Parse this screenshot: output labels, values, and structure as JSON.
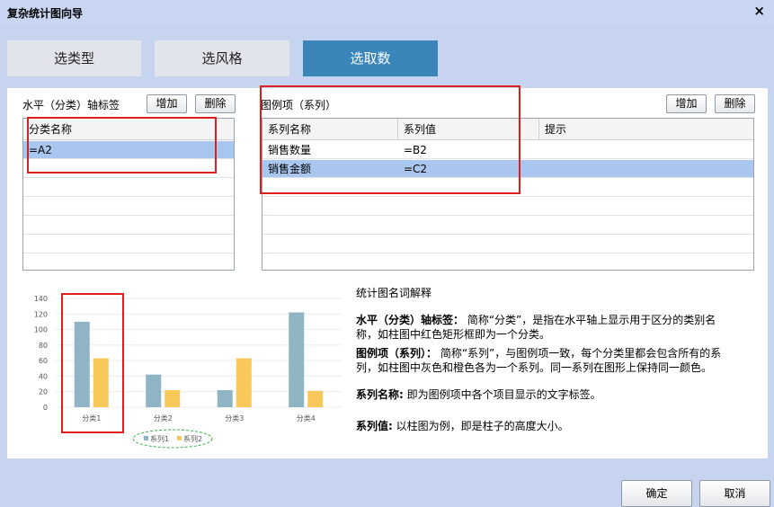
{
  "window": {
    "title": "复杂统计图向导",
    "close_glyph": "×"
  },
  "tabs": [
    {
      "label": "选类型",
      "active": false
    },
    {
      "label": "选风格",
      "active": false
    },
    {
      "label": "选取数",
      "active": true
    }
  ],
  "category_panel": {
    "label": "水平（分类）轴标签",
    "add_label": "增加",
    "delete_label": "删除",
    "column_header": "分类名称",
    "rows": [
      "=A2"
    ]
  },
  "series_panel": {
    "label": "图例项（系列）",
    "add_label": "增加",
    "delete_label": "删除",
    "columns": [
      "系列名称",
      "系列值",
      "提示"
    ],
    "rows": [
      {
        "name": "销售数量",
        "value": "=B2",
        "hint": ""
      },
      {
        "name": "销售金额",
        "value": "=C2",
        "hint": ""
      }
    ]
  },
  "explanation": {
    "title": "统计图名词解释",
    "items": [
      {
        "term": "水平（分类）轴标签：",
        "text": " 简称“分类”，是指在水平轴上显示用于区分的类别名称，如柱图中红色矩形框即为一个分类。"
      },
      {
        "term": "图例项（系列）：",
        "text": "  简称“系列”，与图例项一致，每个分类里都会包含所有的系列，如柱图中灰色和橙色各为一个系列。同一系列在图形上保持同一颜色。"
      },
      {
        "term": "系列名称:",
        "text": "  即为图例项中各个项目显示的文字标签。"
      },
      {
        "term": "系列值:",
        "text": "  以柱图为例，即是柱子的高度大小。"
      }
    ]
  },
  "footer": {
    "ok_label": "确定",
    "cancel_label": "取消"
  },
  "colors": {
    "accent_tab": "#3a85b9",
    "selected_row": "#a9c7ee",
    "highlight_frame": "#e01e1e",
    "series1": "#8fb4c4",
    "series2": "#f8c85a",
    "legend_oval": "#3cb34a"
  },
  "chart_data": {
    "type": "bar",
    "categories": [
      "分类1",
      "分类2",
      "分类3",
      "分类4"
    ],
    "series": [
      {
        "name": "系列1",
        "values": [
          110,
          42,
          22,
          122
        ]
      },
      {
        "name": "系列2",
        "values": [
          63,
          22,
          63,
          21
        ]
      }
    ],
    "ylim": [
      0,
      140
    ],
    "yticks": [
      0,
      20,
      40,
      60,
      80,
      100,
      120,
      140
    ],
    "legend": "bottom",
    "grid": true
  }
}
